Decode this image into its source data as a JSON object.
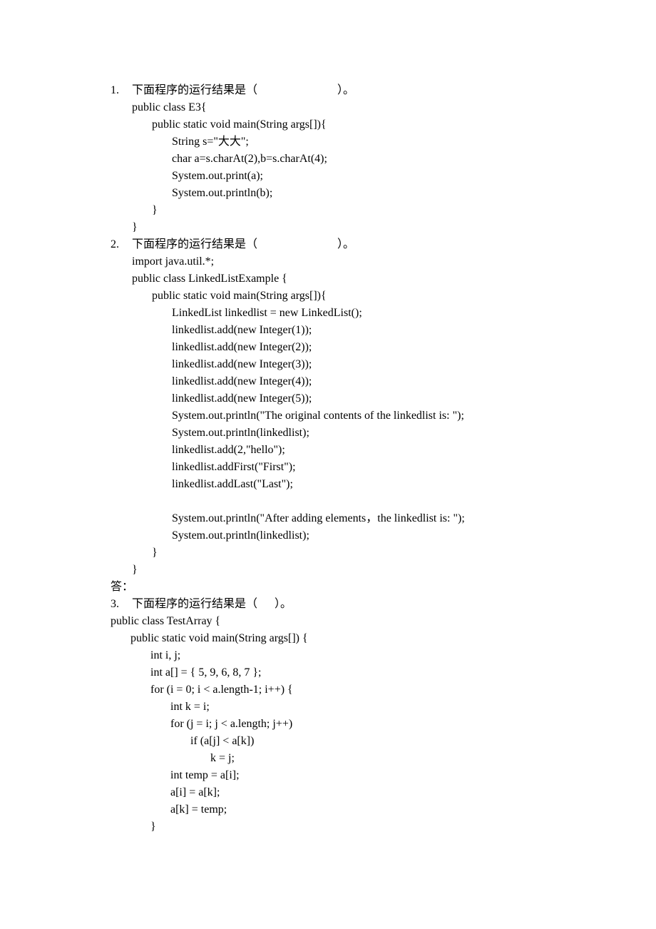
{
  "q1": {
    "num": "1.",
    "prompt": "下面程序的运行结果是（                            ）。",
    "code": [
      "public class E3{",
      "       public static void main(String args[]){",
      "              String s=\"大大\";",
      "              char a=s.charAt(2),b=s.charAt(4);",
      "              System.out.print(a);",
      "              System.out.println(b);",
      "       }",
      "}"
    ]
  },
  "q2": {
    "num": "2.",
    "prompt": "下面程序的运行结果是（                            ）。",
    "code": [
      "import java.util.*;",
      "public class LinkedListExample {",
      "       public static void main(String args[]){",
      "              LinkedList linkedlist = new LinkedList();",
      "              linkedlist.add(new Integer(1));",
      "              linkedlist.add(new Integer(2));",
      "              linkedlist.add(new Integer(3));",
      "              linkedlist.add(new Integer(4));",
      "              linkedlist.add(new Integer(5));",
      "              System.out.println(\"The original contents of the linkedlist is: \");",
      "              System.out.println(linkedlist);",
      "              linkedlist.add(2,\"hello\");",
      "              linkedlist.addFirst(\"First\");",
      "              linkedlist.addLast(\"Last\");",
      "",
      "              System.out.println(\"After adding elements，the linkedlist is: \");",
      "              System.out.println(linkedlist);",
      "       }",
      "}"
    ],
    "answer_label": "答："
  },
  "q3": {
    "num": "3.",
    "prompt": "下面程序的运行结果是（      ）。",
    "code": [
      "public class TestArray {",
      "       public static void main(String args[]) {",
      "              int i, j;",
      "              int a[] = { 5, 9, 6, 8, 7 };",
      "              for (i = 0; i < a.length-1; i++) {",
      "                     int k = i;",
      "                     for (j = i; j < a.length; j++)",
      "                            if (a[j] < a[k])",
      "                                   k = j;",
      "                     int temp = a[i];",
      "                     a[i] = a[k];",
      "                     a[k] = temp;",
      "              }"
    ]
  }
}
